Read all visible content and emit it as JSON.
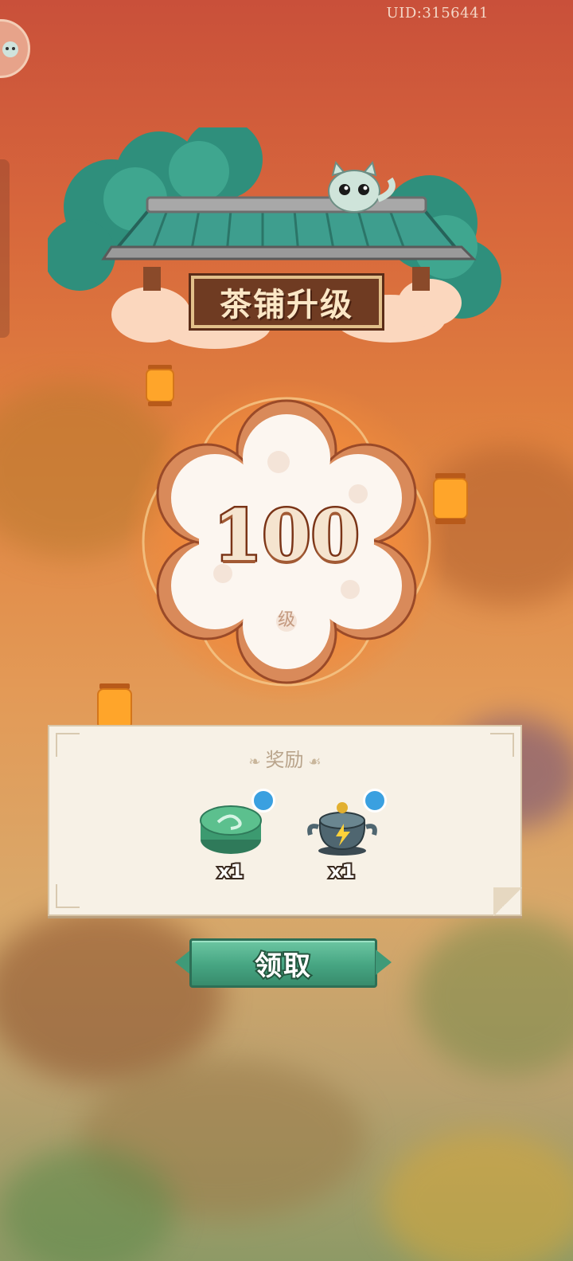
{
  "header": {
    "uid": "UID:3156441"
  },
  "banner": {
    "title": "茶铺升级"
  },
  "level": {
    "number": "100",
    "unit": "级"
  },
  "reward": {
    "title": "奖励",
    "items": [
      {
        "icon": "green-tin-icon",
        "quantity": "x1"
      },
      {
        "icon": "energy-teapot-icon",
        "quantity": "x1"
      }
    ]
  },
  "claim_button": {
    "label": "领取"
  },
  "colors": {
    "accent_green": "#46a582",
    "title_plate": "#6f3b22",
    "glow_orange": "#f08a3c"
  }
}
